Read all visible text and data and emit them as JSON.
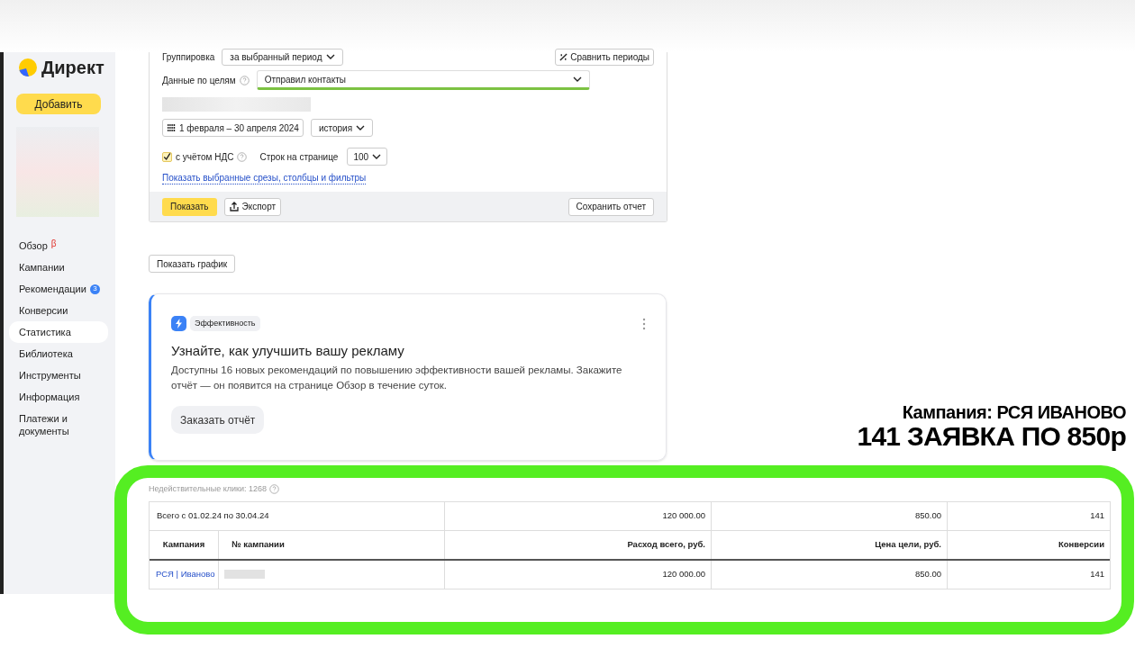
{
  "sidebar": {
    "logo": "Директ",
    "add_button": "Добавить",
    "items": [
      {
        "label": "Обзор",
        "badge": "β",
        "kind": "beta",
        "selected": false
      },
      {
        "label": "Кампании",
        "selected": false
      },
      {
        "label": "Рекомендации",
        "badge": "3",
        "kind": "count",
        "selected": false
      },
      {
        "label": "Конверсии",
        "selected": false
      },
      {
        "label": "Статистика",
        "selected": true
      },
      {
        "label": "Библиотека",
        "selected": false
      },
      {
        "label": "Инструменты",
        "selected": false
      },
      {
        "label": "Информация",
        "selected": false
      },
      {
        "label": "Платежи и документы",
        "selected": false
      }
    ]
  },
  "report_form": {
    "grouping": {
      "label": "Группировка",
      "value": "за выбранный период"
    },
    "compare_button": "Сравнить периоды",
    "goals": {
      "label": "Данные по целям",
      "value": "Отправил контакты"
    },
    "date_range": "1 февраля – 30 апреля 2024",
    "history": "история",
    "vat": {
      "label": "с учётом НДС",
      "checked": true
    },
    "rows_per_page": {
      "label": "Строк на странице",
      "value": "100"
    },
    "filters_link": "Показать выбранные срезы, столбцы и фильтры",
    "show_button": "Показать",
    "export_button": "Экспорт",
    "save_button": "Сохранить отчет"
  },
  "show_chart_button": "Показать график",
  "promo": {
    "tag": "Эффективность",
    "title": "Узнайте, как улучшить вашу рекламу",
    "text": "Доступны 16 новых рекомендаций по повышению эффективности вашей рекламы. Закажите отчёт — он появится на странице Обзор в течение суток.",
    "button": "Заказать отчёт"
  },
  "invalid_clicks": "Недействительные клики: 1268",
  "table": {
    "total_row": {
      "label": "Всего с 01.02.24 по 30.04.24",
      "values": [
        "120 000.00",
        "850.00",
        "141"
      ]
    },
    "columns": [
      "Кампания",
      "№ кампании",
      "Расход всего, руб.",
      "Цена цели, руб.",
      "Конверсии"
    ],
    "rows": [
      {
        "campaign": "РСЯ | Иваново",
        "values": [
          "120 000.00",
          "850.00",
          "141"
        ]
      }
    ]
  },
  "annotation": {
    "line1": "Кампания: РСЯ ИВАНОВО",
    "line2": "141 ЗАЯВКА ПО 850р"
  }
}
